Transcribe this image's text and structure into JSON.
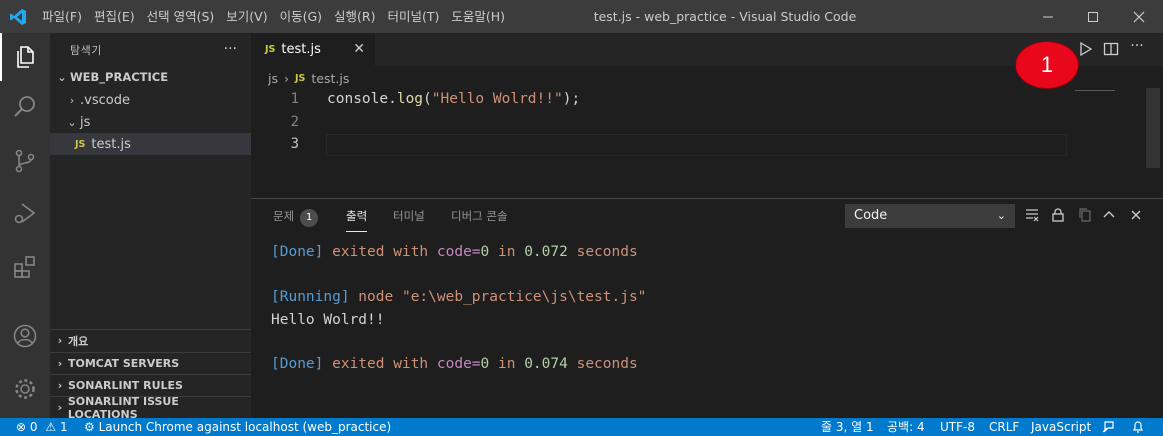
{
  "titlebar": {
    "menu": [
      "파일(F)",
      "편집(E)",
      "선택 영역(S)",
      "보기(V)",
      "이동(G)",
      "실행(R)",
      "터미널(T)",
      "도움말(H)"
    ],
    "title": "test.js - web_practice - Visual Studio Code"
  },
  "sidebar": {
    "title": "탐색기",
    "root": "WEB_PRACTICE",
    "items": [
      ".vscode",
      "js",
      "test.js"
    ],
    "sections": [
      "개요",
      "TOMCAT SERVERS",
      "SONARLINT RULES",
      "SONARLINT ISSUE LOCATIONS"
    ]
  },
  "editor": {
    "tab": "test.js",
    "breadcrumb": [
      "js",
      "test.js"
    ],
    "line_numbers": [
      "1",
      "2",
      "3"
    ],
    "code": {
      "obj": "console",
      "dot": ".",
      "fn": "log",
      "open": "(",
      "str": "\"Hello Wolrd!!\"",
      "close": ");"
    },
    "badge": "1"
  },
  "panel": {
    "tabs": [
      "문제",
      "출력",
      "터미널",
      "디버그 콘솔"
    ],
    "problems_count": "1",
    "channel": "Code",
    "output": {
      "done1": [
        "[Done]",
        " exited ",
        "with",
        " code=",
        "0",
        " in ",
        "0.072",
        " seconds"
      ],
      "running": [
        "[Running]",
        " node ",
        "\"e:\\web_practice\\js\\test.js\""
      ],
      "hello": "Hello Wolrd!!",
      "done2": [
        "[Done]",
        " exited ",
        "with",
        " code=",
        "0",
        " in ",
        "0.074",
        " seconds"
      ]
    }
  },
  "statusbar": {
    "errors": "0",
    "warnings": "1",
    "launch": "Launch Chrome against localhost (web_practice)",
    "position": "줄 3, 열 1",
    "spaces": "공백: 4",
    "encoding": "UTF-8",
    "eol": "CRLF",
    "language": "JavaScript"
  },
  "colors": {
    "accent": "#007acc",
    "badge": "#e8071b"
  }
}
